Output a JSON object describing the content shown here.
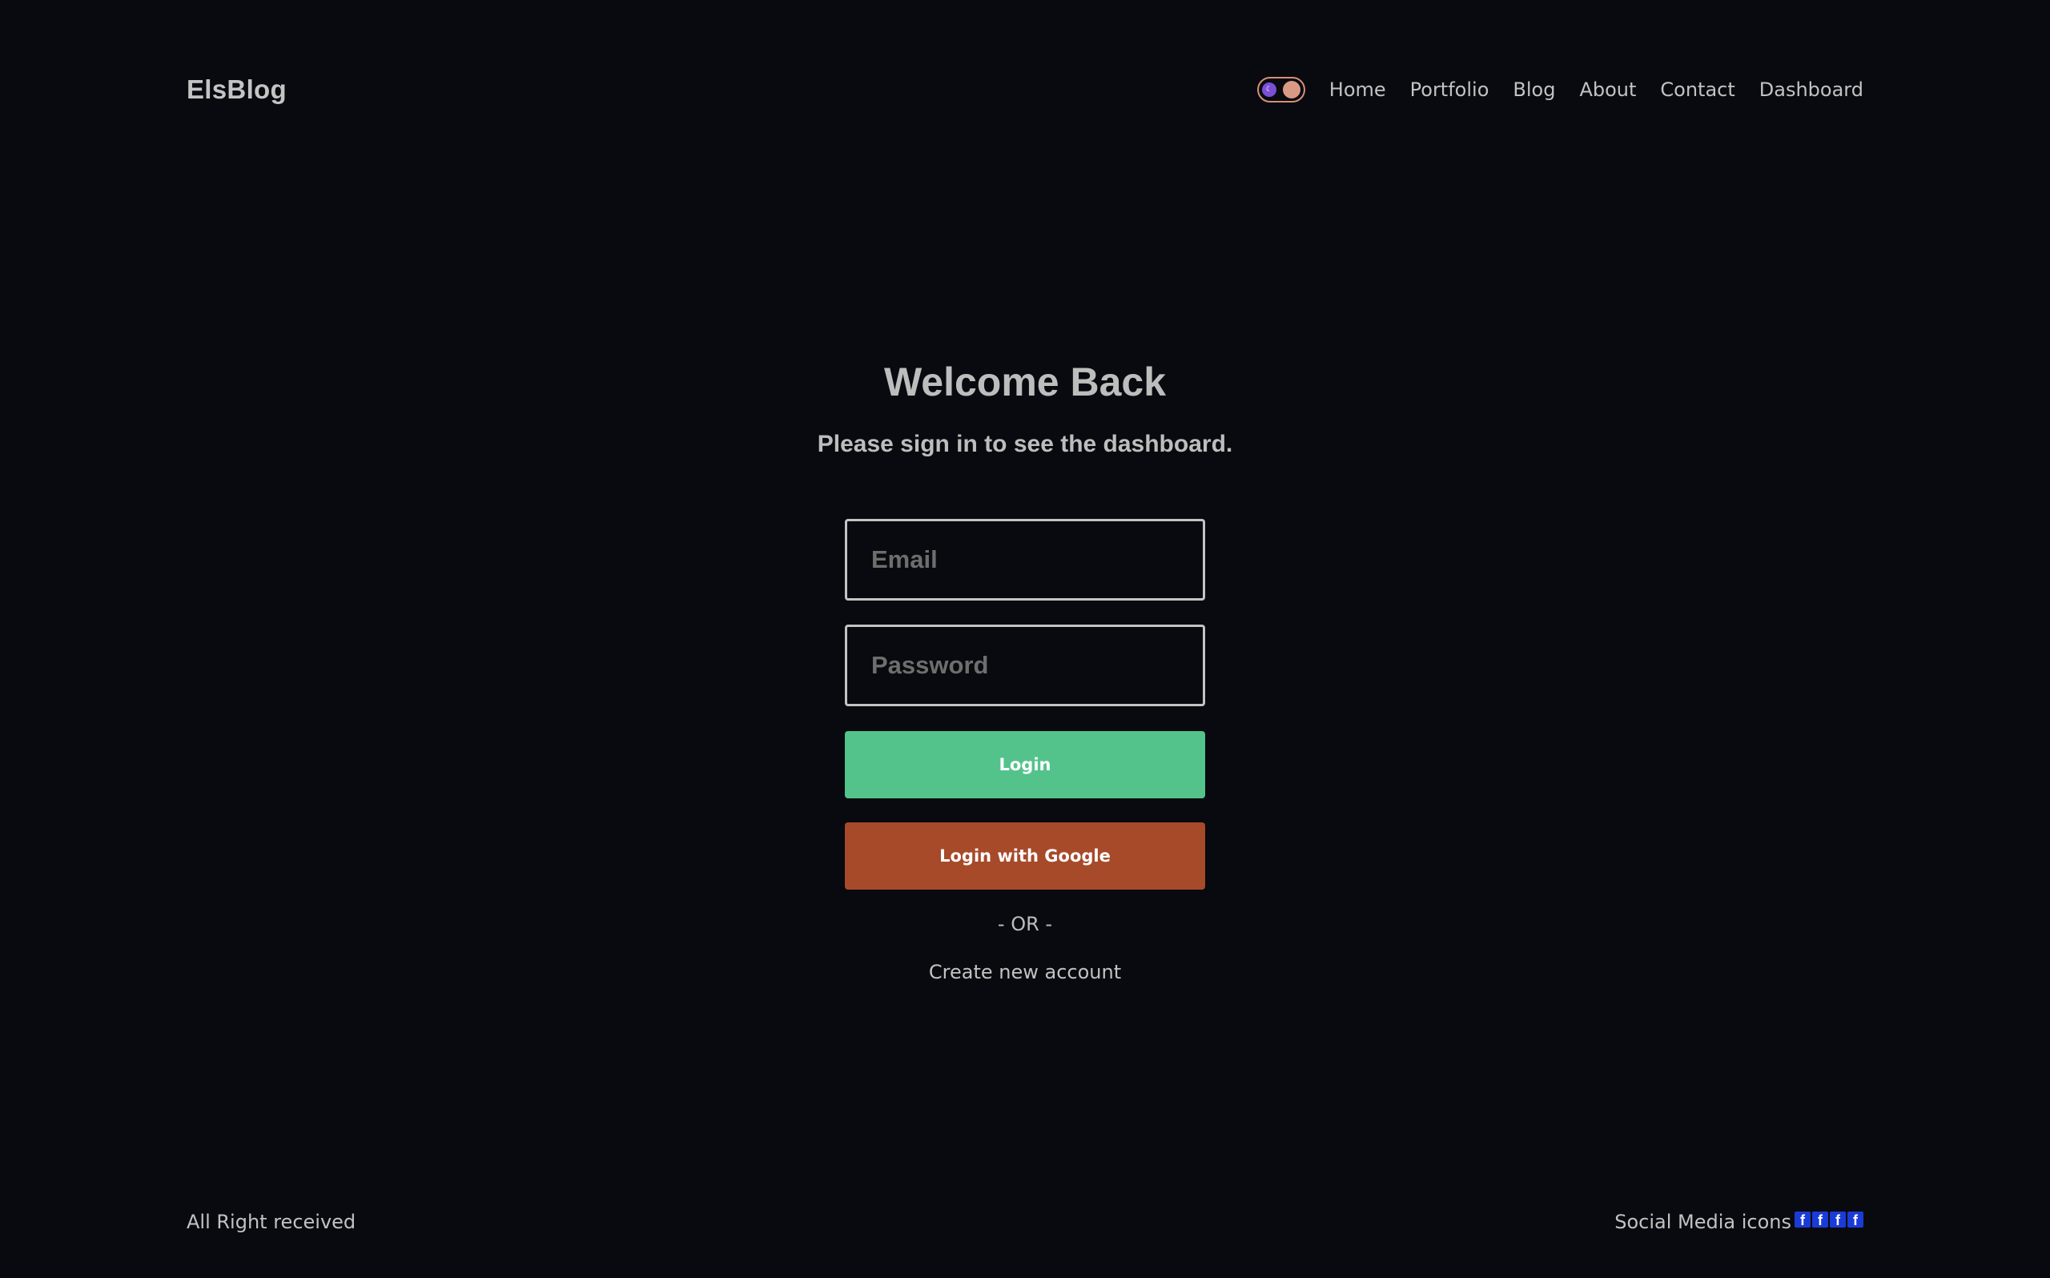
{
  "header": {
    "logo": "ElsBlog",
    "theme_toggle": {
      "moon_icon": "moon-icon",
      "moon_glyph": "☾"
    },
    "nav": [
      "Home",
      "Portfolio",
      "Blog",
      "About",
      "Contact",
      "Dashboard"
    ]
  },
  "main": {
    "title": "Welcome Back",
    "subtitle": "Please sign in to see the dashboard.",
    "email_placeholder": "Email",
    "password_placeholder": "Password",
    "login_label": "Login",
    "google_label": "Login with Google",
    "or_text": "- OR -",
    "create_account": "Create new account"
  },
  "footer": {
    "copyright": "All Right received",
    "social_label": "Social Media icons",
    "social_icons": [
      "facebook-icon",
      "facebook-icon",
      "facebook-icon",
      "facebook-icon"
    ],
    "social_glyph": "f"
  },
  "colors": {
    "background": "#090a0f",
    "login_button": "#53c38b",
    "google_button": "#a74a29",
    "toggle_border": "#d78f78",
    "social_icon_bg": "#1b3bd6"
  }
}
